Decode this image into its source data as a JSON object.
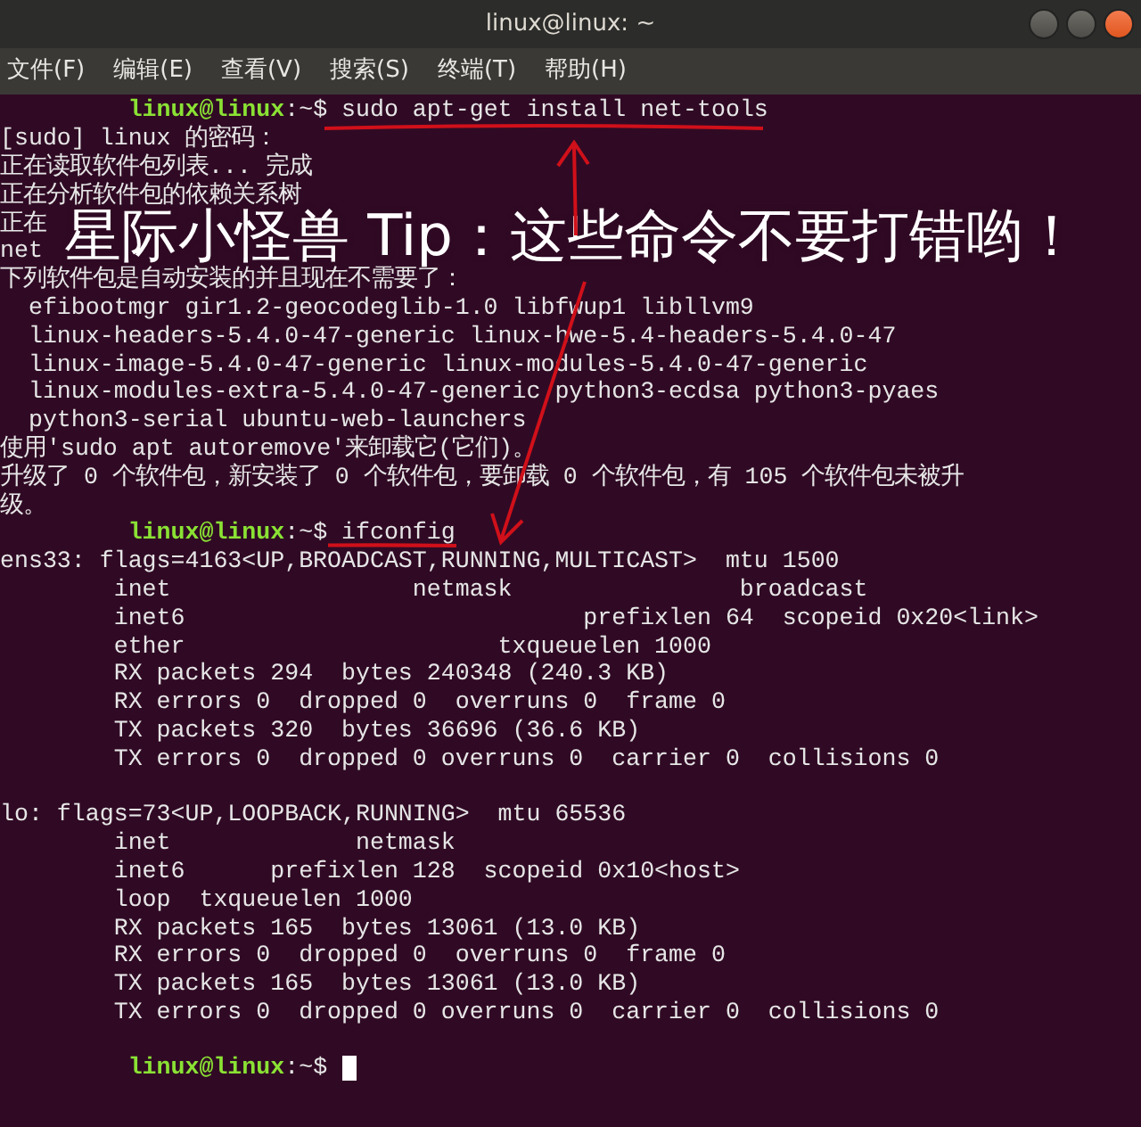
{
  "window": {
    "title": "linux@linux: ~",
    "controls": [
      {
        "kind": "minimize"
      },
      {
        "kind": "maximize"
      },
      {
        "kind": "close"
      }
    ]
  },
  "menu": [
    "文件(F)",
    "编辑(E)",
    "查看(V)",
    "搜索(S)",
    "终端(T)",
    "帮助(H)"
  ],
  "terminal": {
    "lines": [
      {
        "kind": "prompt",
        "user": "linux@linux",
        "path": ":~",
        "symbol": "$",
        "command": "sudo apt-get install net-tools"
      },
      {
        "kind": "output",
        "text": "[sudo] linux 的密码："
      },
      {
        "kind": "output",
        "text": "正在读取软件包列表... 完成"
      },
      {
        "kind": "output",
        "text": "正在分析软件包的依赖关系树"
      },
      {
        "kind": "output",
        "text": "正在"
      },
      {
        "kind": "output",
        "text": "net"
      },
      {
        "kind": "output",
        "text": "下列软件包是自动安装的并且现在不需要了："
      },
      {
        "kind": "output",
        "text": "  efibootmgr gir1.2-geocodeglib-1.0 libfwup1 libllvm9"
      },
      {
        "kind": "output",
        "text": "  linux-headers-5.4.0-47-generic linux-hwe-5.4-headers-5.4.0-47"
      },
      {
        "kind": "output",
        "text": "  linux-image-5.4.0-47-generic linux-modules-5.4.0-47-generic"
      },
      {
        "kind": "output",
        "text": "  linux-modules-extra-5.4.0-47-generic python3-ecdsa python3-pyaes"
      },
      {
        "kind": "output",
        "text": "  python3-serial ubuntu-web-launchers"
      },
      {
        "kind": "output",
        "text": "使用'sudo apt autoremove'来卸载它(它们)。"
      },
      {
        "kind": "output",
        "text": "升级了 0 个软件包，新安装了 0 个软件包，要卸载 0 个软件包，有 105 个软件包未被升"
      },
      {
        "kind": "output",
        "text": "级。"
      },
      {
        "kind": "prompt",
        "user": "linux@linux",
        "path": ":~",
        "symbol": "$",
        "command": "ifconfig"
      },
      {
        "kind": "output",
        "text": "ens33: flags=4163<UP,BROADCAST,RUNNING,MULTICAST>  mtu 1500"
      },
      {
        "kind": "output",
        "text": "        inet                 netmask                broadcast"
      },
      {
        "kind": "output",
        "text": "        inet6                            prefixlen 64  scopeid 0x20<link>"
      },
      {
        "kind": "output",
        "text": "        ether                      txqueuelen 1000"
      },
      {
        "kind": "output",
        "text": "        RX packets 294  bytes 240348 (240.3 KB)"
      },
      {
        "kind": "output",
        "text": "        RX errors 0  dropped 0  overruns 0  frame 0"
      },
      {
        "kind": "output",
        "text": "        TX packets 320  bytes 36696 (36.6 KB)"
      },
      {
        "kind": "output",
        "text": "        TX errors 0  dropped 0 overruns 0  carrier 0  collisions 0"
      },
      {
        "kind": "blank"
      },
      {
        "kind": "output",
        "text": "lo: flags=73<UP,LOOPBACK,RUNNING>  mtu 65536"
      },
      {
        "kind": "output",
        "text": "        inet             netmask"
      },
      {
        "kind": "output",
        "text": "        inet6      prefixlen 128  scopeid 0x10<host>"
      },
      {
        "kind": "output",
        "text": "        loop  txqueuelen 1000"
      },
      {
        "kind": "output",
        "text": "        RX packets 165  bytes 13061 (13.0 KB)"
      },
      {
        "kind": "output",
        "text": "        RX errors 0  dropped 0  overruns 0  frame 0"
      },
      {
        "kind": "output",
        "text": "        TX packets 165  bytes 13061 (13.0 KB)"
      },
      {
        "kind": "output",
        "text": "        TX errors 0  dropped 0 overruns 0  carrier 0  collisions 0"
      },
      {
        "kind": "blank"
      },
      {
        "kind": "prompt",
        "user": "linux@linux",
        "path": ":~",
        "symbol": "$",
        "cursor": true
      }
    ]
  },
  "annotation": {
    "text": "星际小怪兽 Tip：这些命令不要打错哟！",
    "marks": [
      {
        "kind": "underline"
      },
      {
        "kind": "arrow-up"
      },
      {
        "kind": "arrow-down"
      },
      {
        "kind": "underline-short"
      }
    ]
  }
}
